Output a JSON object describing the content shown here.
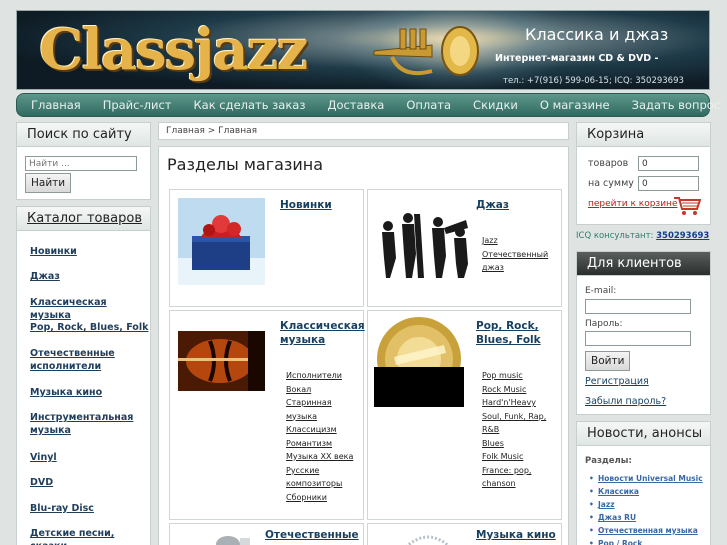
{
  "header": {
    "logo_text": "Classjazz",
    "title": "Классика и джаз",
    "subtitle": "Интернет-магазин CD & DVD -",
    "phone": "тел.: +7(916) 599-06-15;   ICQ: 350293693"
  },
  "nav": [
    {
      "label": "Главная"
    },
    {
      "label": "Прайс-лист"
    },
    {
      "label": "Как сделать заказ"
    },
    {
      "label": "Доставка"
    },
    {
      "label": "Оплата"
    },
    {
      "label": "Скидки"
    },
    {
      "label": "О магазине"
    },
    {
      "label": "Задать вопрос"
    }
  ],
  "search": {
    "title": "Поиск по сайту",
    "placeholder": "Найти ...",
    "button": "Найти"
  },
  "catalog": {
    "title": "Каталог товаров",
    "items": [
      "Новинки",
      "Джаз",
      "Классическая музыка",
      "Pop, Rock, Blues, Folk",
      "Отечественные исполнители",
      "Музыка кино",
      "Инструментальная музыка",
      "Vinyl",
      "DVD",
      "Blu-ray Disc",
      "Детские песни, сказки"
    ]
  },
  "breadcrumb": "Главная > Главная",
  "main": {
    "title": "Разделы магазина",
    "tiles": [
      {
        "title": "Новинки",
        "subs": []
      },
      {
        "title": "Джаз",
        "subs": [
          "Jazz",
          "Отечественный джаз"
        ]
      },
      {
        "title": "Классическая музыка",
        "subs": [
          "Исполнители",
          "Вокал",
          "Старинная музыка",
          "Классицизм",
          "Романтизм",
          "Музыка XX века",
          "Русские композиторы",
          "Сборники"
        ]
      },
      {
        "title": "Pop, Rock, Blues, Folk",
        "subs": [
          "Pop music",
          "Rock Music",
          "Hard'n'Heavy",
          "Soul, Funk, Rap, R&B",
          "Blues",
          "Folk Music",
          "France: pop, chanson"
        ]
      },
      {
        "title": "Отечественные",
        "subs": []
      },
      {
        "title": "Музыка кино",
        "subs": []
      }
    ]
  },
  "cart": {
    "title": "Корзина",
    "items_label": "товаров",
    "items_value": "0",
    "sum_label": "на сумму",
    "sum_value": "0",
    "link": "перейти к корзине"
  },
  "icq": {
    "label": "ICQ консультант:",
    "number": "350293693"
  },
  "clients": {
    "title": "Для клиентов",
    "email_label": "E-mail:",
    "password_label": "Пароль:",
    "login_button": "Войти",
    "register": "Регистрация",
    "forgot": "Забыли пароль?"
  },
  "news": {
    "title": "Новости, анонсы",
    "sections_label": "Разделы:",
    "items": [
      "Новости Universal Music",
      "Классика",
      "Jazz",
      "Джаз RU",
      "Отечественная музыка",
      "Pop / Rock"
    ]
  }
}
